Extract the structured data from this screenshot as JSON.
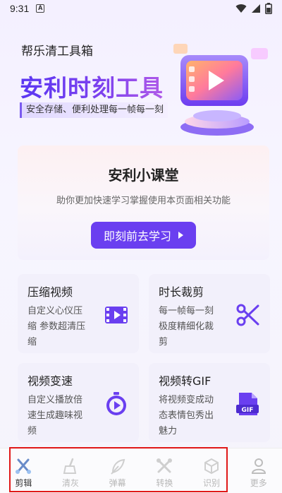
{
  "status": {
    "time": "9:31",
    "app_badge": "A"
  },
  "header": {
    "brand": "帮乐清工具箱",
    "title": "安利时刻工具",
    "subtitle": "安全存储、便利处理每一帧每一刻"
  },
  "course": {
    "title": "安利小课堂",
    "desc": "助你更加快速学习掌握使用本页面相关功能",
    "button": "即刻前去学习"
  },
  "cards": [
    {
      "title": "压缩视频",
      "desc": "自定义心仪压缩 参数超清压缩",
      "icon": "film-icon"
    },
    {
      "title": "时长裁剪",
      "desc": "每一帧每一刻极度精细化裁剪",
      "icon": "scissors-icon"
    },
    {
      "title": "视频变速",
      "desc": "自定义播放倍速生成趣味视频",
      "icon": "stopwatch-play-icon"
    },
    {
      "title": "视频转GIF",
      "desc": "将视频变成动态表情包秀出魅力",
      "icon": "gif-file-icon",
      "icon_text": "GIF"
    }
  ],
  "tabs": [
    {
      "label": "剪辑",
      "active": true
    },
    {
      "label": "清灰"
    },
    {
      "label": "弹幕"
    },
    {
      "label": "转换"
    },
    {
      "label": "识别"
    },
    {
      "label": "更多"
    }
  ],
  "colors": {
    "accent": "#6a3ff0",
    "card_bg": "#f2f0fb",
    "highlight": "#e01818"
  }
}
